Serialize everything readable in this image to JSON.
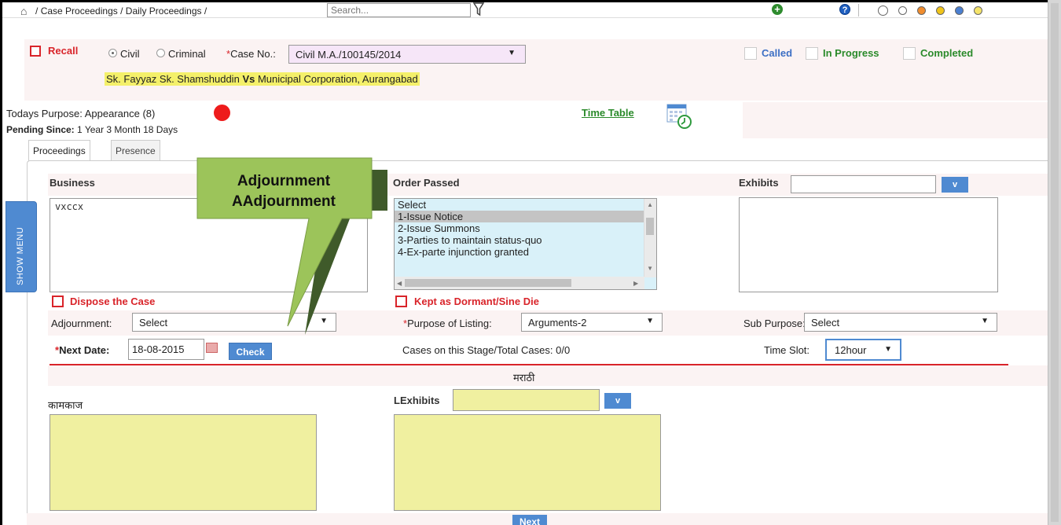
{
  "breadcrumb": {
    "items": [
      "Case Proceedings",
      "Daily Proceedings"
    ],
    "separator": "/"
  },
  "search": {
    "placeholder": "Search..."
  },
  "icons": {
    "home": "home-icon",
    "filter": "filter-icon",
    "add": "add-icon",
    "help": "help-icon",
    "calendar": "calendar-clock-icon"
  },
  "theme_dots": [
    "#ffffff",
    "#ffffff",
    "#f08c2e",
    "#f0c419",
    "#4a7fd1",
    "#f5e46a"
  ],
  "header": {
    "recall_label": "Recall",
    "civil_label": "Civil",
    "criminal_label": "Criminal",
    "case_no_label": "Case No.:",
    "case_no_required": "*",
    "case_no_value": "Civil M.A./100145/2014",
    "party_1": "Sk. Fayyaz Sk. Shamshuddin",
    "vs": "Vs",
    "party_2": "Municipal Corporation, Aurangabad",
    "status": {
      "called": "Called",
      "in_progress": "In Progress",
      "completed": "Completed"
    }
  },
  "info": {
    "todays_purpose_label": "Todays Purpose:",
    "todays_purpose_value": "Appearance (8)",
    "pending_since_label": "Pending Since:",
    "pending_since_value": "1 Year 3 Month 18 Days",
    "time_table_link": "Time Table"
  },
  "tabs": [
    {
      "label": "Proceedings"
    },
    {
      "label": "Presence"
    }
  ],
  "proceedings": {
    "business_label": "Business",
    "business_value": "vxccx",
    "order_passed_label": "Order Passed",
    "order_options": [
      "Select",
      "1-Issue Notice",
      "2-Issue Summons",
      "3-Parties to maintain status-quo",
      "4-Ex-parte injunction granted"
    ],
    "order_selected": "1-Issue Notice",
    "exhibits_label": "Exhibits",
    "exhibits_button": "v",
    "dispose_label": "Dispose the Case",
    "dormant_label": "Kept as Dormant/Sine Die",
    "adjournment_label": "Adjournment:",
    "adjournment_value": "Select",
    "purpose_listing_label": "Purpose of Listing:",
    "purpose_listing_value": "Arguments-2",
    "sub_purpose_label": "Sub Purpose:",
    "sub_purpose_value": "Select",
    "next_date_label": "Next Date:",
    "next_date_value": "18-08-2015",
    "check_button": "Check",
    "cases_stage_label": "Cases on this Stage/Total Cases:",
    "cases_stage_value": "0/0",
    "time_slot_label": "Time Slot:",
    "time_slot_value": "12hour",
    "marathi_heading": "मराठी",
    "kamkaj_label": "कामकाज",
    "lexhibits_label": "LExhibits",
    "lexhibits_button": "v",
    "next_button": "Next"
  },
  "show_menu": "SHOW MENU",
  "callout": {
    "line1": "Adjournment",
    "line2": "AAdjournment"
  }
}
